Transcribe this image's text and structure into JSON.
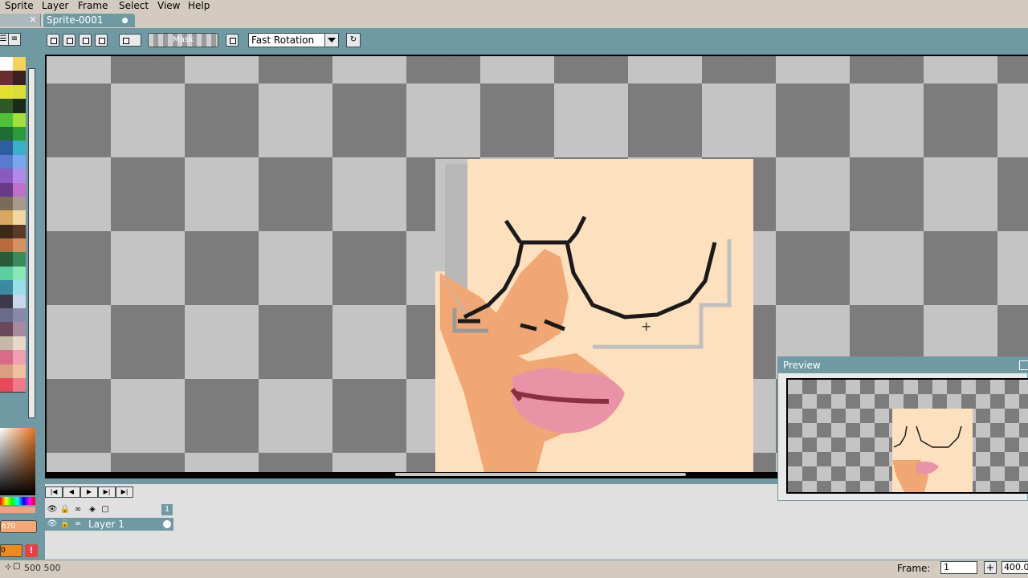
{
  "menubar": {
    "items": [
      {
        "label": "Sprite"
      },
      {
        "label": "Layer"
      },
      {
        "label": "Frame"
      },
      {
        "label": "Select"
      },
      {
        "label": "View"
      },
      {
        "label": "Help"
      }
    ]
  },
  "tabs": {
    "other_close": "×",
    "active_label": "Sprite-0001"
  },
  "toolbar": {
    "mask_label": "Mask",
    "rotation_value": "Fast Rotation"
  },
  "palette": {
    "colors": [
      "#ffffff",
      "#f5d35a",
      "#6b2e2e",
      "#3b2020",
      "#e5e030",
      "#d8dd38",
      "#2e5a2a",
      "#1c2a18",
      "#4fc23a",
      "#a2e03a",
      "#1e6e34",
      "#2a9a3a",
      "#2e5ea0",
      "#3ab0c8",
      "#5a7ad0",
      "#7aa8f0",
      "#8a5ac0",
      "#b08ae8",
      "#6a3a8a",
      "#c070c8",
      "#7a6a5a",
      "#a89a8a",
      "#d8a860",
      "#f0d8a0",
      "#3a2a1a",
      "#5a3a2a",
      "#b86a3a",
      "#d89060",
      "#2a5a3a",
      "#3a8a5a",
      "#5ad0a0",
      "#8ae8b8",
      "#3a8aa0",
      "#9ae0e8",
      "#3a3a4a",
      "#c8d8e8",
      "#6a6a8a",
      "#8a8aa8",
      "#6a4a5a",
      "#a88aa0",
      "#c8b8a8",
      "#e8d8c8",
      "#d86a8a",
      "#f0a0b0",
      "#d8a080",
      "#f0c0a0",
      "#e84a5a",
      "#f07a8a"
    ]
  },
  "color_panel": {
    "value_text": "670",
    "fg_text": "0",
    "warn_icon": "!"
  },
  "timeline": {
    "frame_number": "1",
    "layer_name": "Layer 1"
  },
  "preview": {
    "title": "Preview"
  },
  "statusbar": {
    "status_text": "500 500",
    "frame_label": "Frame:",
    "frame_value": "1",
    "plus_label": "+",
    "zoom_value": "400.0"
  }
}
